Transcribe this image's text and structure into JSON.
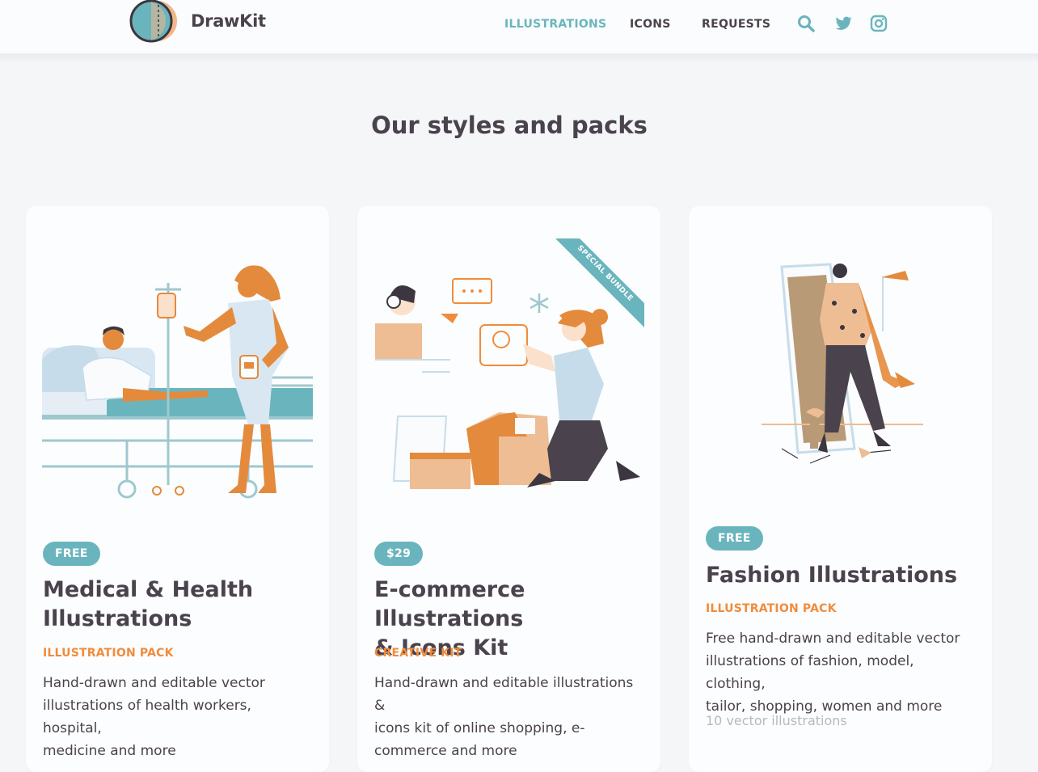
{
  "header": {
    "logo_text": "DrawKit",
    "nav": [
      {
        "label": "ILLUSTRATIONS",
        "active": true
      },
      {
        "label": "ICONS",
        "active": false
      },
      {
        "label": "REQUESTS",
        "active": false
      }
    ],
    "icons": [
      "search-icon",
      "twitter-icon",
      "instagram-icon"
    ]
  },
  "section": {
    "title": "Our styles and packs"
  },
  "cards": [
    {
      "badge": "FREE",
      "title_line1": "Medical & Health",
      "title_line2": "Illustrations",
      "type": "ILLUSTRATION PACK",
      "desc_line1": "Hand-drawn and editable vector",
      "desc_line2": "illustrations of health workers, hospital,",
      "desc_line3": "medicine and more"
    },
    {
      "badge": "$29",
      "ribbon": "SPECIAL BUNDLE",
      "title_line1": "E-commerce Illustrations",
      "title_line2": "& Icons Kit",
      "type": "CREATIVE KIT",
      "desc_line1": "Hand-drawn and editable illustrations &",
      "desc_line2": "icons kit of online shopping, e-",
      "desc_line3": "commerce and more"
    },
    {
      "badge": "FREE",
      "title_line1": "Fashion Illustrations",
      "type": "ILLUSTRATION PACK",
      "desc_line1": "Free hand-drawn and editable vector",
      "desc_line2": "illustrations of fashion, model, clothing,",
      "desc_line3": "tailor, shopping, women and more",
      "count": "10 vector illustrations"
    }
  ],
  "colors": {
    "accent_teal": "#6ab5bd",
    "accent_orange": "#f08c3c",
    "text_dark": "#4a424c",
    "muted": "#b7b9bf",
    "page_bg": "#f4f6f8"
  }
}
